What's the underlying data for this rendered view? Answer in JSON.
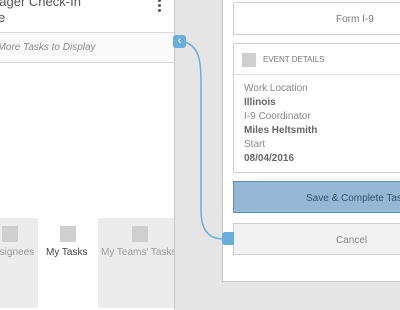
{
  "left_panel": {
    "card_title": "Manager Check-In",
    "card_sub": "e",
    "no_tasks_text": "No More Tasks to Display",
    "tabs": [
      {
        "label": "Assignees",
        "active": false
      },
      {
        "label": "My Tasks",
        "active": true
      },
      {
        "label": "My Teams' Tasks",
        "active": false
      }
    ]
  },
  "right_panel": {
    "form_title": "Form I-9",
    "event_details_header": "EVENT DETAILS",
    "fields": [
      {
        "label": "Work Location",
        "value": "Illinois"
      },
      {
        "label": "I-9 Coordinator",
        "value": "Miles Heltsmith"
      },
      {
        "label": "Start",
        "value": "08/04/2016"
      }
    ],
    "save_label": "Save & Complete Task",
    "cancel_label": "Cancel"
  },
  "colors": {
    "accent": "#6aaee0",
    "save_button": "#94b8d6",
    "background": "#e5e5e5"
  },
  "icons": [
    "kebab-menu-icon",
    "chevron-left-icon",
    "tab-placeholder-icon",
    "event-details-icon"
  ]
}
